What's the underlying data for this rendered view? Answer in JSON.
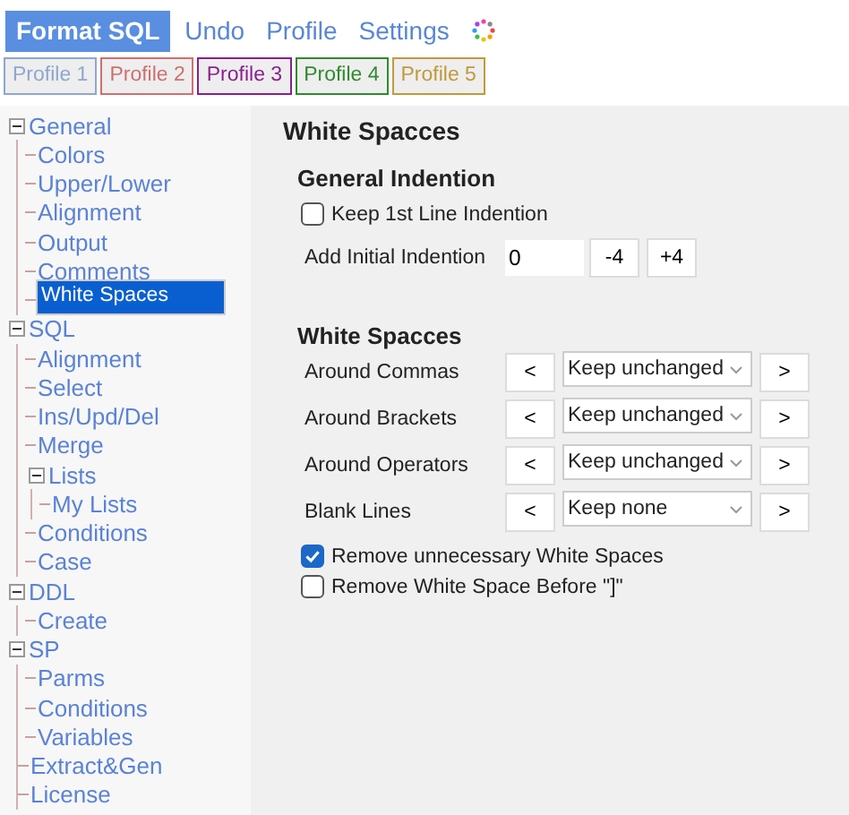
{
  "menu": [
    {
      "label": "Format SQL",
      "selected": true
    },
    {
      "label": "Undo",
      "selected": false
    },
    {
      "label": "Profile",
      "selected": false
    },
    {
      "label": "Settings",
      "selected": false
    }
  ],
  "profiles": [
    {
      "label": "Profile 1",
      "color": "#8fa6cf"
    },
    {
      "label": "Profile 2",
      "color": "#cf6f6f"
    },
    {
      "label": "Profile 3",
      "color": "#8a1f8f"
    },
    {
      "label": "Profile 4",
      "color": "#2f8a2f"
    },
    {
      "label": "Profile 5",
      "color": "#c09a3a"
    }
  ],
  "tree": [
    {
      "label": "General",
      "expanded": true,
      "selected": false,
      "children": [
        {
          "label": "Colors",
          "selected": false
        },
        {
          "label": "Upper/Lower",
          "selected": false
        },
        {
          "label": "Alignment",
          "selected": false
        },
        {
          "label": "Output",
          "selected": false
        },
        {
          "label": "Comments",
          "selected": false
        },
        {
          "label": "White Spaces",
          "selected": true
        }
      ]
    },
    {
      "label": "SQL",
      "expanded": true,
      "selected": false,
      "children": [
        {
          "label": "Alignment",
          "selected": false
        },
        {
          "label": "Select",
          "selected": false
        },
        {
          "label": "Ins/Upd/Del",
          "selected": false
        },
        {
          "label": "Merge",
          "selected": false
        },
        {
          "label": "Lists",
          "expanded": true,
          "selected": false,
          "children": [
            {
              "label": "My Lists",
              "selected": false
            }
          ]
        },
        {
          "label": "Conditions",
          "selected": false
        },
        {
          "label": "Case",
          "selected": false
        }
      ]
    },
    {
      "label": "DDL",
      "expanded": true,
      "selected": false,
      "children": [
        {
          "label": "Create",
          "selected": false
        }
      ]
    },
    {
      "label": "SP",
      "expanded": true,
      "selected": false,
      "children": [
        {
          "label": "Parms",
          "selected": false
        },
        {
          "label": "Conditions",
          "selected": false
        },
        {
          "label": "Variables",
          "selected": false
        }
      ]
    },
    {
      "label": "Extract&Gen",
      "selected": false
    },
    {
      "label": "License",
      "selected": false
    }
  ],
  "panel": {
    "title": "White Spacces",
    "indention": {
      "title": "General Indention",
      "keep_first_line": {
        "label": "Keep 1st Line Indention",
        "checked": false
      },
      "initial": {
        "label": "Add Initial Indention",
        "value": "0",
        "buttons": [
          "-4",
          "+4"
        ]
      }
    },
    "spaces": {
      "title": "White Spacces",
      "rows": [
        {
          "label": "Around Commas",
          "prev": "<",
          "value": "Keep unchanged",
          "next": ">"
        },
        {
          "label": "Around Brackets",
          "prev": "<",
          "value": "Keep unchanged",
          "next": ">"
        },
        {
          "label": "Around Operators",
          "prev": "<",
          "value": "Keep unchanged",
          "next": ">"
        },
        {
          "label": "Blank Lines",
          "prev": "<",
          "value": "Keep none",
          "next": ">"
        }
      ]
    },
    "options": [
      {
        "label": "Remove unnecessary White Spaces",
        "checked": true
      },
      {
        "label": "Remove White Space Before \"]\"",
        "checked": false
      }
    ]
  }
}
